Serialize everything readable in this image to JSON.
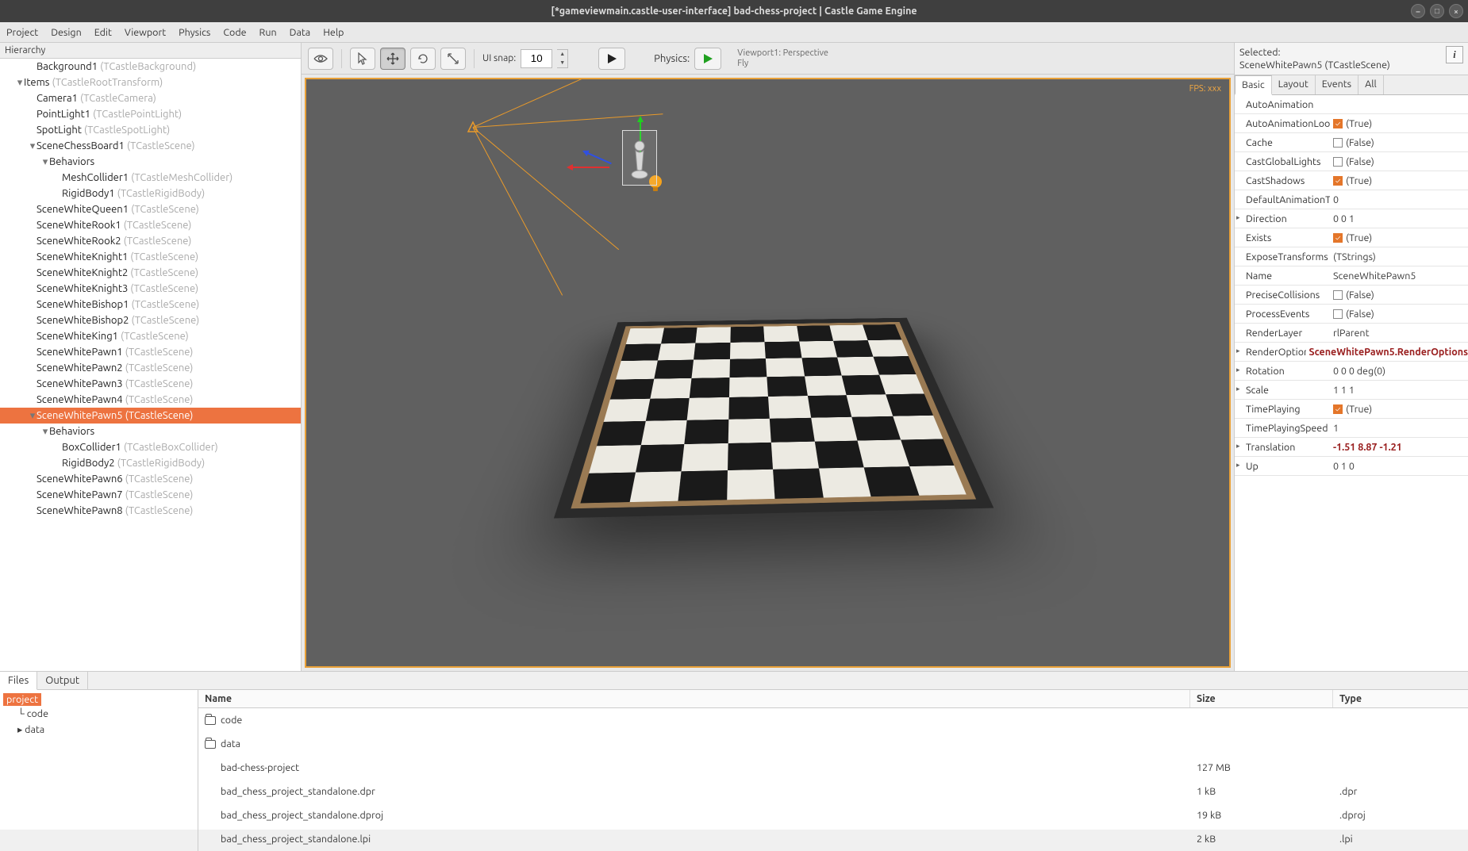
{
  "window": {
    "title": "[*gameviewmain.castle-user-interface] bad-chess-project | Castle Game Engine"
  },
  "menu": [
    "Project",
    "Design",
    "Edit",
    "Viewport",
    "Physics",
    "Code",
    "Run",
    "Data",
    "Help"
  ],
  "hierarchy": {
    "title": "Hierarchy",
    "items": [
      {
        "d": 2,
        "name": "Background1",
        "type": "(TCastleBackground)"
      },
      {
        "d": 1,
        "caret": "▾",
        "name": "Items",
        "type": "(TCastleRootTransform)"
      },
      {
        "d": 2,
        "name": "Camera1",
        "type": "(TCastleCamera)"
      },
      {
        "d": 2,
        "name": "PointLight1",
        "type": "(TCastlePointLight)"
      },
      {
        "d": 2,
        "name": "SpotLight",
        "type": "(TCastleSpotLight)"
      },
      {
        "d": 2,
        "caret": "▾",
        "name": "SceneChessBoard1",
        "type": "(TCastleScene)"
      },
      {
        "d": 3,
        "caret": "▾",
        "name": "Behaviors",
        "type": ""
      },
      {
        "d": 4,
        "name": "MeshCollider1",
        "type": "(TCastleMeshCollider)"
      },
      {
        "d": 4,
        "name": "RigidBody1",
        "type": "(TCastleRigidBody)"
      },
      {
        "d": 2,
        "name": "SceneWhiteQueen1",
        "type": "(TCastleScene)"
      },
      {
        "d": 2,
        "name": "SceneWhiteRook1",
        "type": "(TCastleScene)"
      },
      {
        "d": 2,
        "name": "SceneWhiteRook2",
        "type": "(TCastleScene)"
      },
      {
        "d": 2,
        "name": "SceneWhiteKnight1",
        "type": "(TCastleScene)"
      },
      {
        "d": 2,
        "name": "SceneWhiteKnight2",
        "type": "(TCastleScene)"
      },
      {
        "d": 2,
        "name": "SceneWhiteKnight3",
        "type": "(TCastleScene)"
      },
      {
        "d": 2,
        "name": "SceneWhiteBishop1",
        "type": "(TCastleScene)"
      },
      {
        "d": 2,
        "name": "SceneWhiteBishop2",
        "type": "(TCastleScene)"
      },
      {
        "d": 2,
        "name": "SceneWhiteKing1",
        "type": "(TCastleScene)"
      },
      {
        "d": 2,
        "name": "SceneWhitePawn1",
        "type": "(TCastleScene)"
      },
      {
        "d": 2,
        "name": "SceneWhitePawn2",
        "type": "(TCastleScene)"
      },
      {
        "d": 2,
        "name": "SceneWhitePawn3",
        "type": "(TCastleScene)"
      },
      {
        "d": 2,
        "name": "SceneWhitePawn4",
        "type": "(TCastleScene)"
      },
      {
        "d": 2,
        "caret": "▾",
        "name": "SceneWhitePawn5",
        "type": "(TCastleScene)",
        "selected": true
      },
      {
        "d": 3,
        "caret": "▾",
        "name": "Behaviors",
        "type": ""
      },
      {
        "d": 4,
        "name": "BoxCollider1",
        "type": "(TCastleBoxCollider)"
      },
      {
        "d": 4,
        "name": "RigidBody2",
        "type": "(TCastleRigidBody)"
      },
      {
        "d": 2,
        "name": "SceneWhitePawn6",
        "type": "(TCastleScene)"
      },
      {
        "d": 2,
        "name": "SceneWhitePawn7",
        "type": "(TCastleScene)"
      },
      {
        "d": 2,
        "name": "SceneWhitePawn8",
        "type": "(TCastleScene)"
      }
    ]
  },
  "toolbar": {
    "snap_label": "UI snap:",
    "snap_value": "10",
    "physics_label": "Physics:",
    "viewport_info_1": "Viewport1: Perspective",
    "viewport_info_2": "Fly"
  },
  "viewport": {
    "fps": "FPS: xxx"
  },
  "inspector": {
    "sel_label": "Selected:",
    "sel_name": "SceneWhitePawn5 (TCastleScene)",
    "tabs": [
      "Basic",
      "Layout",
      "Events",
      "All"
    ],
    "props": [
      {
        "k": "AutoAnimation",
        "v": ""
      },
      {
        "k": "AutoAnimationLoop",
        "cb": true,
        "v": "(True)"
      },
      {
        "k": "Cache",
        "cb": false,
        "v": "(False)"
      },
      {
        "k": "CastGlobalLights",
        "cb": false,
        "v": "(False)"
      },
      {
        "k": "CastShadows",
        "cb": true,
        "v": "(True)"
      },
      {
        "k": "DefaultAnimationTransition",
        "v": "0"
      },
      {
        "k": "Direction",
        "v": "0 0 1",
        "exp": true
      },
      {
        "k": "Exists",
        "cb": true,
        "v": "(True)"
      },
      {
        "k": "ExposeTransforms",
        "v": "(TStrings)"
      },
      {
        "k": "Name",
        "v": "SceneWhitePawn5"
      },
      {
        "k": "PreciseCollisions",
        "cb": false,
        "v": "(False)"
      },
      {
        "k": "ProcessEvents",
        "cb": false,
        "v": "(False)"
      },
      {
        "k": "RenderLayer",
        "v": "rlParent"
      },
      {
        "k": "RenderOptions",
        "v": "SceneWhitePawn5.RenderOptions",
        "exp": true,
        "bold": true,
        "changed": true
      },
      {
        "k": "Rotation",
        "v": "0 0 0 deg(0)",
        "exp": true
      },
      {
        "k": "Scale",
        "v": "1 1 1",
        "exp": true
      },
      {
        "k": "TimePlaying",
        "cb": true,
        "v": "(True)"
      },
      {
        "k": "TimePlayingSpeed",
        "v": "1"
      },
      {
        "k": "Translation",
        "v": "-1.51 8.87 -1.21",
        "exp": true,
        "bold": true,
        "changed": true
      },
      {
        "k": "Up",
        "v": "0 1 0",
        "exp": true
      }
    ]
  },
  "bottom": {
    "tabs": [
      "Files",
      "Output"
    ],
    "dir_root": "project",
    "dirs": [
      "code",
      "data"
    ],
    "headers": {
      "name": "Name",
      "size": "Size",
      "type": "Type"
    },
    "files": [
      {
        "name": "code",
        "folder": true,
        "size": "",
        "type": ""
      },
      {
        "name": "data",
        "folder": true,
        "size": "",
        "type": ""
      },
      {
        "name": "bad-chess-project",
        "size": "127 MB",
        "type": ""
      },
      {
        "name": "bad_chess_project_standalone.dpr",
        "size": "1 kB",
        "type": ".dpr"
      },
      {
        "name": "bad_chess_project_standalone.dproj",
        "size": "19 kB",
        "type": ".dproj"
      },
      {
        "name": "bad_chess_project_standalone.lpi",
        "size": "2 kB",
        "type": ".lpi"
      }
    ]
  }
}
